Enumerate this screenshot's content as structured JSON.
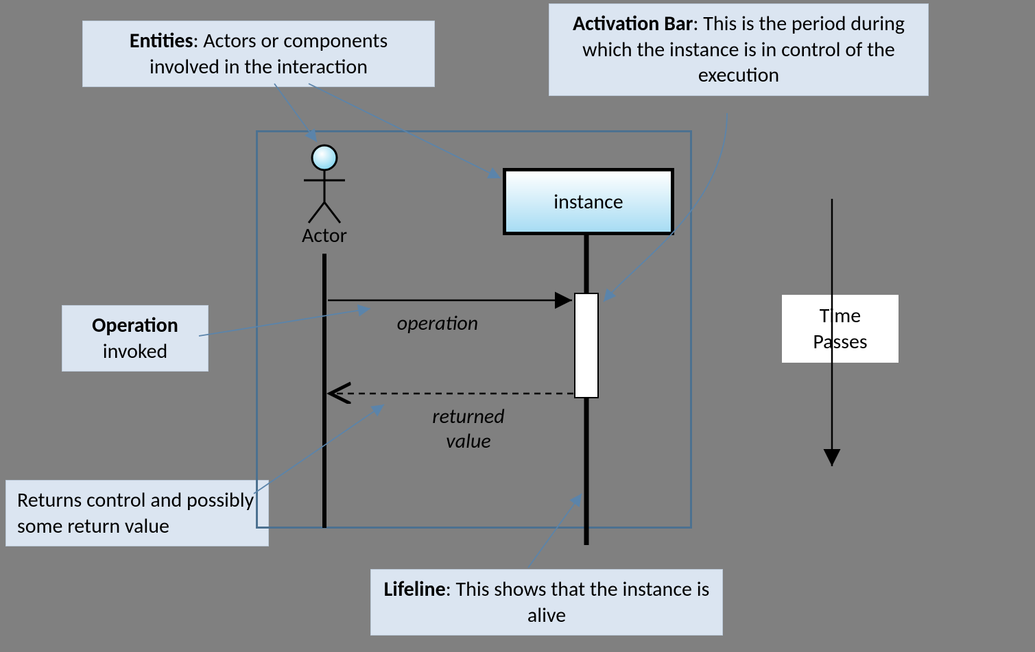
{
  "callouts": {
    "entities": {
      "title": "Entities",
      "desc": ":  Actors or components involved in the interaction"
    },
    "activation": {
      "title": "Activation Bar",
      "desc": ": This is the period during which the instance is in control of the execution"
    },
    "operation": {
      "title": "Operation",
      "desc": "invoked"
    },
    "returns": {
      "desc": "Returns control and possibly some return value"
    },
    "lifeline": {
      "title": "Lifeline",
      "desc": ": This shows that the instance is alive"
    }
  },
  "diagram": {
    "actor_label": "Actor",
    "instance_label": "instance",
    "operation_label": "operation",
    "return_label_line1": "returned",
    "return_label_line2": "value"
  },
  "time": {
    "line1": "Time",
    "line2": "Passes"
  }
}
